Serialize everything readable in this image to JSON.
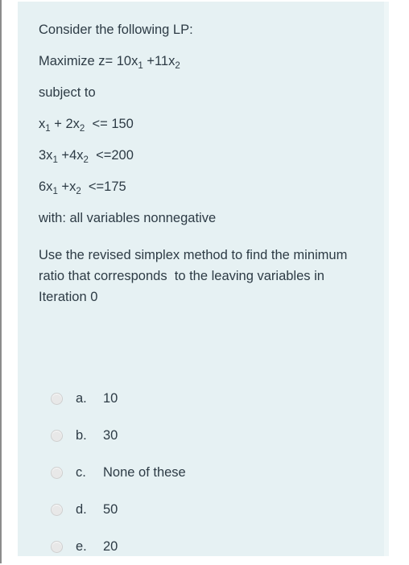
{
  "panel": {
    "background_color": "#e6f1f3",
    "text_color": "#2d3b45"
  },
  "question": {
    "stem_lines": [
      {
        "id": "intro",
        "text": "Consider the following LP:"
      },
      {
        "id": "objective",
        "html": "Maximize z= 10x<sub>1</sub> +11x<sub>2</sub>"
      },
      {
        "id": "subject-to",
        "text": "subject to"
      },
      {
        "id": "constraint-1",
        "html": "x<sub>1</sub> + 2x<sub>2</sub>  <= 150"
      },
      {
        "id": "constraint-2",
        "html": "3x<sub>1</sub> +4x<sub>2</sub>  <=200"
      },
      {
        "id": "constraint-3",
        "html": "6x<sub>1</sub> +x<sub>2</sub>  <=175"
      },
      {
        "id": "nonnegative",
        "text": "with: all variables nonnegative"
      }
    ],
    "instruction": "Use the revised simplex method to find the minimum ratio that corresponds  to the leaving variables in Iteration 0"
  },
  "answers": {
    "options": [
      {
        "letter": "a.",
        "text": "10",
        "selected": false
      },
      {
        "letter": "b.",
        "text": "30",
        "selected": false
      },
      {
        "letter": "c.",
        "text": "None of these",
        "selected": false
      },
      {
        "letter": "d.",
        "text": "50",
        "selected": false
      },
      {
        "letter": "e.",
        "text": "20",
        "selected": false
      }
    ]
  }
}
